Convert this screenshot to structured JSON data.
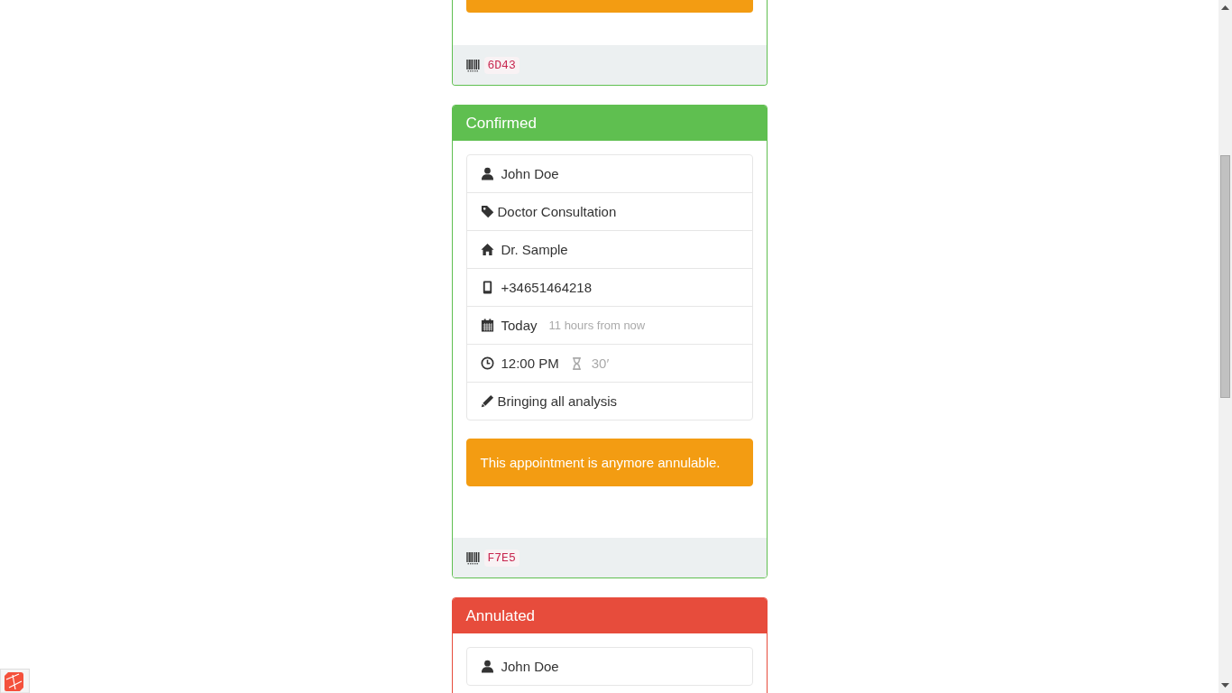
{
  "appointments": [
    {
      "kind": "success",
      "alert": {
        "kind": "warning"
      },
      "code": "6D43"
    },
    {
      "kind": "success",
      "status": "Confirmed",
      "details": [
        {
          "kind": "client",
          "text": "John Doe"
        },
        {
          "kind": "service",
          "text": "Doctor Consultation"
        },
        {
          "kind": "provider",
          "text": "Dr. Sample"
        },
        {
          "kind": "phone",
          "text": "+34651464218"
        },
        {
          "kind": "date",
          "text": "Today",
          "note": "11 hours from now"
        },
        {
          "kind": "time",
          "text": "12:00 PM",
          "duration": "30′"
        },
        {
          "kind": "notes",
          "text": "Bringing all analysis"
        }
      ],
      "alert": {
        "kind": "warning",
        "text": "This appointment is anymore annulable."
      },
      "code": "F7E5"
    },
    {
      "kind": "danger",
      "status": "Annulated",
      "details": [
        {
          "kind": "client",
          "text": "John Doe"
        }
      ]
    }
  ]
}
